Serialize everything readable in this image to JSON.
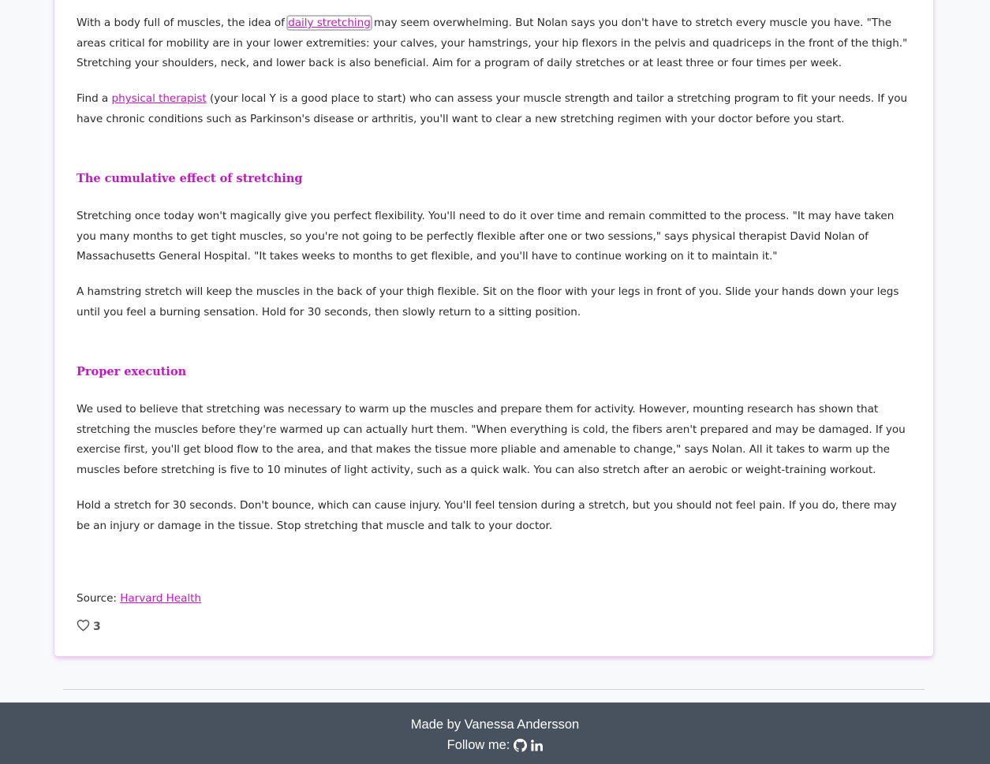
{
  "article": {
    "p1": {
      "before": "With a body full of muscles, the idea of ",
      "link": "daily stretching",
      "after": " may seem overwhelming. But Nolan says you don't have to stretch every muscle you have. \"The areas critical for mobility are in your lower extremities: your calves, your hamstrings, your hip flexors in the pelvis and quadriceps in the front of the thigh.\" Stretching your shoulders, neck, and lower back is also beneficial. Aim for a program of daily stretches or at least three or four times per week."
    },
    "p2": {
      "before": "Find a ",
      "link": "physical therapist",
      "after": " (your local Y is a good place to start) who can assess your muscle strength and tailor a stretching program to fit your needs. If you have chronic conditions such as Parkinson's disease or arthritis, you'll want to clear a new stretching regimen with your doctor before you start."
    },
    "heading1": "The cumulative effect of stretching",
    "p3": "Stretching once today won't magically give you perfect flexibility. You'll need to do it over time and remain committed to the process. \"It may have taken you many months to get tight muscles, so you're not going to be perfectly flexible after one or two sessions,\" says physical therapist David Nolan of Massachusetts General Hospital. \"It takes weeks to months to get flexible, and you'll have to continue working on it to maintain it.\"",
    "p4": "A hamstring stretch will keep the muscles in the back of your thigh flexible. Sit on the floor with your legs in front of you. Slide your hands down your legs until you feel a burning sensation. Hold for 30 seconds, then slowly return to a sitting position.",
    "heading2": "Proper execution",
    "p5": "We used to believe that stretching was necessary to warm up the muscles and prepare them for activity. However, mounting research has shown that stretching the muscles before they're warmed up can actually hurt them. \"When everything is cold, the fibers aren't prepared and may be damaged. If you exercise first, you'll get blood flow to the area, and that makes the tissue more pliable and amenable to change,\" says Nolan. All it takes to warm up the muscles before stretching is five to 10 minutes of light activity, such as a quick walk. You can also stretch after an aerobic or weight-training workout.",
    "p6": "Hold a stretch for 30 seconds. Don't bounce, which can cause injury. You'll feel tension during a stretch, but you should not feel pain. If you do, there may be an injury or damage in the tissue. Stop stretching that muscle and talk to your doctor.",
    "source_label": "Source: ",
    "source_link": "Harvard Health",
    "likes": "3"
  },
  "footer": {
    "made_by": "Made by Vanessa Andersson",
    "follow": "Follow me:",
    "icons": [
      "github-icon",
      "linkedin-icon"
    ]
  },
  "colors": {
    "accent": "#c218c2",
    "footer_bg": "#47525e",
    "page_bg": "#f8f9fb"
  }
}
